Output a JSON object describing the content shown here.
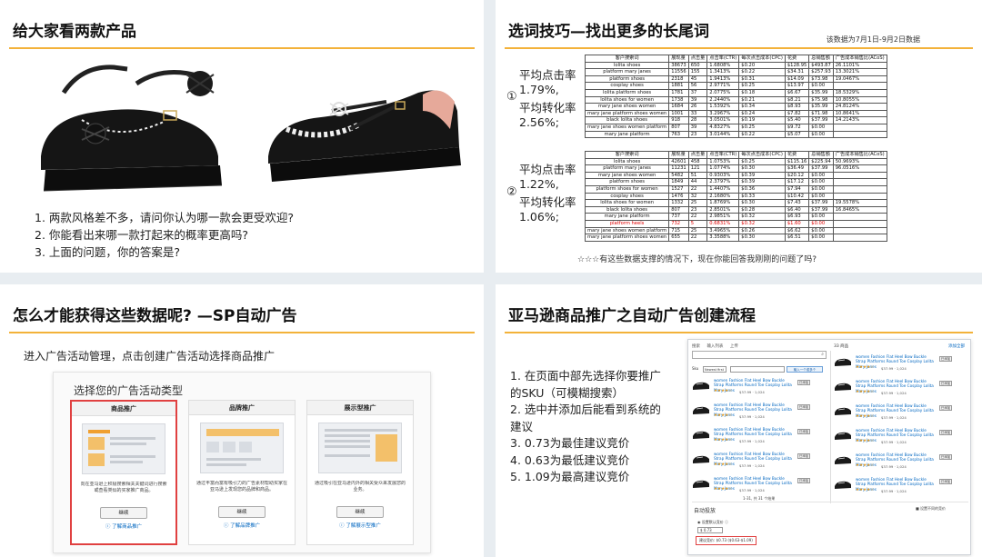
{
  "slide1": {
    "title": "给大家看两款产品",
    "questions": [
      "1.  两款风格差不多，请问你认为哪一款会更受欢迎?",
      "2.  你能看出来哪一款打起来的概率更高吗?",
      "3.  上面的问题，你的答案是?"
    ]
  },
  "slide2": {
    "title": "选词技巧—找出更多的长尾词",
    "note": "该数据为7月1日-9月2日数据",
    "group1": {
      "marker": "①",
      "ctr_label": "平均点击率",
      "ctr_value": "1.79%,",
      "cvr_label": "平均转化率",
      "cvr_value": "2.56%;"
    },
    "group2": {
      "marker": "②",
      "ctr_label": "平均点击率",
      "ctr_value": "1.22%,",
      "cvr_label": "平均转化率",
      "cvr_value": "1.06%;"
    },
    "headers": [
      "客户搜索词",
      "展现量",
      "点击量",
      "点击率(CTR)",
      "每次点击成本(CPC)",
      "花费",
      "总销售额",
      "广告成本销售比(ACoS)"
    ],
    "table1": [
      [
        "lolita shoes",
        "38673",
        "650",
        "1.6808%",
        "$0.20",
        "$128.95",
        "$493.87",
        "26.1101%"
      ],
      [
        "platform mary janes",
        "11556",
        "155",
        "1.3413%",
        "$0.22",
        "$34.31",
        "$257.93",
        "13.3021%"
      ],
      [
        "platform shoes",
        "2318",
        "45",
        "1.9413%",
        "$0.31",
        "$14.09",
        "$73.98",
        "19.0467%"
      ],
      [
        "cosplay shoes",
        "1881",
        "56",
        "2.9771%",
        "$0.25",
        "$13.97",
        "$0.00",
        ""
      ],
      [
        "lolita platform shoes",
        "1781",
        "37",
        "2.0775%",
        "$0.18",
        "$6.67",
        "$35.99",
        "18.5329%"
      ],
      [
        "lolita shoes for women",
        "1738",
        "39",
        "2.2440%",
        "$0.21",
        "$8.21",
        "$75.98",
        "10.8055%"
      ],
      [
        "mary jane shoes women",
        "1684",
        "26",
        "1.5392%",
        "$0.34",
        "$8.93",
        "$35.99",
        "24.8124%"
      ],
      [
        "mary jane platform shoes women",
        "1001",
        "33",
        "3.2967%",
        "$0.24",
        "$7.82",
        "$71.98",
        "10.8641%"
      ],
      [
        "black lolita shoes",
        "918",
        "28",
        "3.0501%",
        "$0.19",
        "$5.40",
        "$37.99",
        "14.2143%"
      ],
      [
        "mary jane shoes women platform",
        "807",
        "39",
        "4.8327%",
        "$0.25",
        "$9.72",
        "$0.00",
        ""
      ],
      [
        "mary jane platform",
        "763",
        "23",
        "3.0144%",
        "$0.22",
        "$5.07",
        "$0.00",
        ""
      ]
    ],
    "table2": [
      [
        "lolita shoes",
        "42601",
        "458",
        "1.0753%",
        "$0.25",
        "$115.16",
        "$225.94",
        "50.9693%"
      ],
      [
        "platform mary janes",
        "11231",
        "121",
        "1.0774%",
        "$0.30",
        "$36.49",
        "$37.99",
        "96.0516%"
      ],
      [
        "mary jane shoes women",
        "5482",
        "51",
        "0.9303%",
        "$0.39",
        "$20.12",
        "$0.00",
        ""
      ],
      [
        "platform shoes",
        "1849",
        "44",
        "2.3797%",
        "$0.39",
        "$17.12",
        "$0.00",
        ""
      ],
      [
        "platform shoes for women",
        "1527",
        "22",
        "1.4407%",
        "$0.36",
        "$7.94",
        "$0.00",
        ""
      ],
      [
        "cosplay shoes",
        "1476",
        "32",
        "2.1680%",
        "$0.33",
        "$10.42",
        "$0.00",
        ""
      ],
      [
        "lolita shoes for women",
        "1332",
        "25",
        "1.8769%",
        "$0.30",
        "$7.43",
        "$37.99",
        "19.5578%"
      ],
      [
        "black lolita shoes",
        "807",
        "23",
        "2.8501%",
        "$0.28",
        "$6.40",
        "$37.99",
        "16.8465%"
      ],
      [
        "mary jane platform",
        "737",
        "22",
        "2.9851%",
        "$0.32",
        "$6.93",
        "$0.00",
        ""
      ],
      [
        "platform heels",
        "732",
        "5",
        "0.6831%",
        "$0.32",
        "$1.60",
        "$0.00",
        ""
      ],
      [
        "mary jane shoes women platform",
        "715",
        "25",
        "3.4965%",
        "$0.26",
        "$6.62",
        "$0.00",
        ""
      ],
      [
        "mary jane platform shoes women",
        "655",
        "22",
        "3.3588%",
        "$0.30",
        "$6.51",
        "$0.00",
        ""
      ]
    ],
    "table2_highlight_row": 9,
    "footer": "☆☆☆有这些数据支撑的情况下，现在你能回答我刚刚的问题了吗?"
  },
  "slide3": {
    "title": "怎么才能获得这些数据呢? —SP自动广告",
    "intro": "进入广告活动管理，点击创建广告活动选择商品推广",
    "panel_title": "选择您的广告活动类型",
    "cards": [
      {
        "title": "商品推广",
        "desc": "向在亚马逊上积极搜索相关关键词进行搜索或查看类似的买家推广商品。",
        "button": "继续",
        "link": "ⓘ 了解商品推广"
      },
      {
        "title": "品牌推广",
        "desc": "通过丰富而富有吸引力的广告素材帮助买家在亚马逊上发现您的品牌和商品。",
        "button": "继续",
        "link": "ⓘ 了解品牌推广"
      },
      {
        "title": "展示型推广",
        "desc": "通过吸引在亚马逊内外的相关受众来发展您的业务。",
        "button": "继续",
        "link": "ⓘ 了解展示型推广"
      }
    ]
  },
  "slide4": {
    "title": "亚马逊商品推广之自动广告创建流程",
    "steps": [
      "1.  在页面中部先选择你要推广",
      "     的SKU（可模糊搜索）",
      "2.  选中并添加后能看到系统的",
      "     建议",
      "3.  0.73为最佳建议竞价",
      "4.  0.63为最低建议竞价",
      "5.  1.09为最高建议竞价"
    ],
    "ui": {
      "tabs": [
        "搜索",
        "输入列表",
        "上传"
      ],
      "count": "33 商品",
      "add_all": "添加全部",
      "search_label": "Sku",
      "search_select": "Newest first",
      "search_button": "输入一个或多个",
      "product_title": "women Fashion Flat Heel Bow Buckle Strap Platforms Round Toe Cosplay Lolita Mary Janes",
      "stars": "★★★★☆",
      "price": "$37.99 · 1,024",
      "add_button": "已添加",
      "pager": "1-31, 共 31 个结果",
      "bid_title": "自动投放",
      "bid_collapse": "■ 设置不同的竞价",
      "bid_radio": "◉ 设置默认竞价 ⓘ",
      "bid_value": "$ 0.73",
      "bid_suggest": "建议竞价: $0.73 ($0.63-$1.09)"
    }
  }
}
